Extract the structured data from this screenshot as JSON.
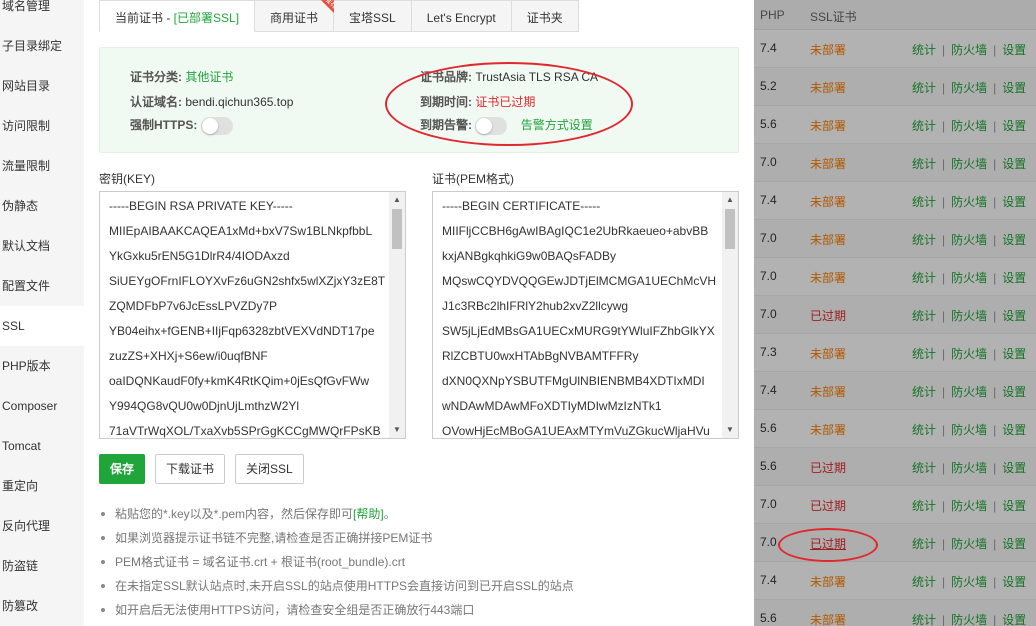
{
  "sidebar": {
    "items": [
      {
        "label": "域名管理"
      },
      {
        "label": "子目录绑定"
      },
      {
        "label": "网站目录"
      },
      {
        "label": "访问限制"
      },
      {
        "label": "流量限制"
      },
      {
        "label": "伪静态"
      },
      {
        "label": "默认文档"
      },
      {
        "label": "配置文件"
      },
      {
        "label": "SSL",
        "active": true
      },
      {
        "label": "PHP版本"
      },
      {
        "label": "Composer"
      },
      {
        "label": "Tomcat"
      },
      {
        "label": "重定向"
      },
      {
        "label": "反向代理"
      },
      {
        "label": "防盗链"
      },
      {
        "label": "防篡改"
      }
    ]
  },
  "tabs": {
    "current": {
      "prefix": "当前证书 - ",
      "status": "[已部署SSL]"
    },
    "commercial": "商用证书",
    "recommend_badge": "推荐",
    "baota": "宝塔SSL",
    "letsencrypt": "Let's Encrypt",
    "folder": "证书夹"
  },
  "cert_info": {
    "category_label": "证书分类:",
    "category_value": "其他证书",
    "domain_label": "认证域名:",
    "domain_value": "bendi.qichun365.top",
    "https_label": "强制HTTPS:",
    "brand_label": "证书品牌:",
    "brand_value": "TrustAsia TLS RSA CA",
    "expire_label": "到期时间:",
    "expire_value": "证书已过期",
    "alert_label": "到期告警:",
    "alert_link": "告警方式设置"
  },
  "key_box": {
    "label": "密钥(KEY)",
    "lines": [
      "-----BEGIN RSA PRIVATE KEY-----",
      "MIIEpAIBAAKCAQEA1xMd+bxV7Sw1BLNkpfbbL",
      "YkGxku5rEN5G1DlrR4/4IODAxzd",
      "SiUEYgOFrnIFLOYXvFz6uGN2shfx5wlXZjxY3zE8T",
      "ZQMDFbP7v6JcEssLPVZDy7P",
      "YB04eihx+fGENB+IIjFqp6328zbtVEXVdNDT17pe",
      "zuzZS+XHXj+S6ew/i0uqfBNF",
      "oaIDQNKaudF0fy+kmK4RtKQim+0jEsQfGvFWw",
      "Y994QG8vQU0w0DjnUjLmthzW2Yl",
      "71aVTrWqXOL/TxaXvb5SPrGgKCCgMWQrFPsKB"
    ]
  },
  "cert_box": {
    "label": "证书(PEM格式)",
    "lines": [
      "-----BEGIN CERTIFICATE-----",
      "MIIFljCCBH6gAwIBAgIQC1e2UbRkaeueo+abvBB",
      "kxjANBgkqhkiG9w0BAQsFADBy",
      "MQswCQYDVQQGEwJDTjElMCMGA1UEChMcVH",
      "J1c3RBc2lhIFRlY2hub2xvZ2llcywg",
      "SW5jLjEdMBsGA1UECxMURG9tYWluIFZhbGlkYX",
      "RlZCBTU0wxHTAbBgNVBAMTFFRy",
      "dXN0QXNpYSBUTFMgUlNBIENBMB4XDTIxMDI",
      "wNDAwMDAwMFoXDTIyMDIwMzIzNTk1",
      "OVowHjEcMBoGA1UEAxMTYmVuZGkucWljaHVu"
    ]
  },
  "buttons": {
    "save": "保存",
    "download": "下载证书",
    "close_ssl": "关闭SSL"
  },
  "tips": {
    "t1_prefix": "粘贴您的*.key以及*.pem内容，然后保存即可",
    "t1_help": "[帮助]",
    "t1_suffix": "。",
    "t2": "如果浏览器提示证书链不完整,请检查是否正确拼接PEM证书",
    "t3": "PEM格式证书 = 域名证书.crt + 根证书(root_bundle).crt",
    "t4": "在未指定SSL默认站点时,未开启SSL的站点使用HTTPS会直接访问到已开启SSL的站点",
    "t5": "如开启后无法使用HTTPS访问，请检查安全组是否正确放行443端口"
  },
  "site_table": {
    "header_php": "PHP",
    "header_ssl": "SSL证书",
    "op_stats": "统计",
    "op_firewall": "防火墙",
    "op_settings": "设置",
    "op_sep": "|",
    "rows": [
      {
        "php": "7.4",
        "ssl": "未部署",
        "status": "none"
      },
      {
        "php": "5.2",
        "ssl": "未部署",
        "status": "none"
      },
      {
        "php": "5.6",
        "ssl": "未部署",
        "status": "none"
      },
      {
        "php": "7.0",
        "ssl": "未部署",
        "status": "none"
      },
      {
        "php": "7.4",
        "ssl": "未部署",
        "status": "none"
      },
      {
        "php": "7.0",
        "ssl": "未部署",
        "status": "none"
      },
      {
        "php": "7.0",
        "ssl": "未部署",
        "status": "none"
      },
      {
        "php": "7.0",
        "ssl": "已过期",
        "status": "expired"
      },
      {
        "php": "7.3",
        "ssl": "未部署",
        "status": "none"
      },
      {
        "php": "7.4",
        "ssl": "未部署",
        "status": "none"
      },
      {
        "php": "5.6",
        "ssl": "未部署",
        "status": "none"
      },
      {
        "php": "5.6",
        "ssl": "已过期",
        "status": "expired"
      },
      {
        "php": "7.0",
        "ssl": "已过期",
        "status": "expired"
      },
      {
        "php": "7.0",
        "ssl": "已过期",
        "status": "expired-link"
      },
      {
        "php": "7.4",
        "ssl": "未部署",
        "status": "none"
      },
      {
        "php": "5.6",
        "ssl": "未部署",
        "status": "none"
      }
    ]
  },
  "colors": {
    "accent": "#20a53a",
    "danger": "#e6292d",
    "warning": "#ff7f00",
    "annotation": "#e0292d"
  }
}
